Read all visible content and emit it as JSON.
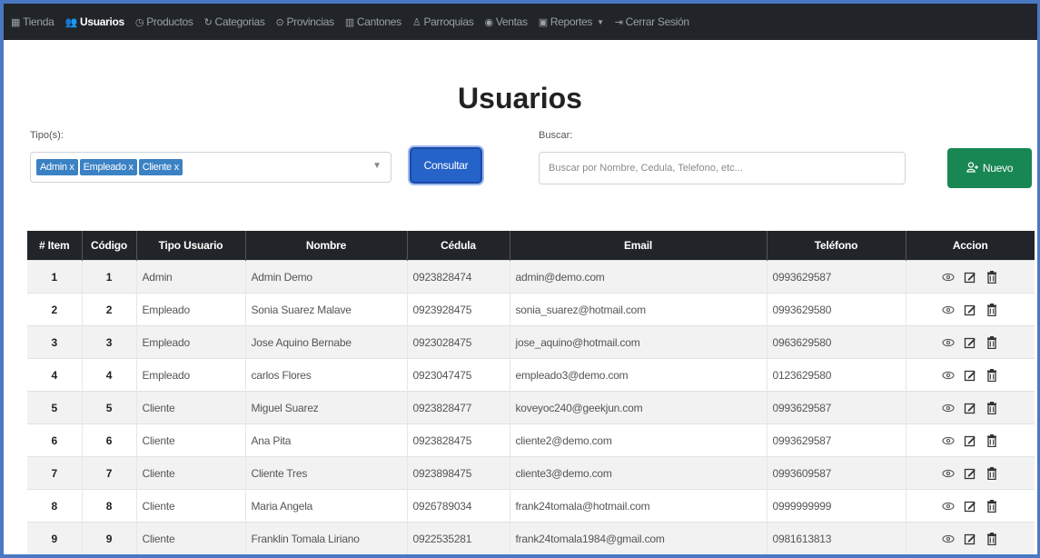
{
  "nav": {
    "items": [
      {
        "label": "Tienda",
        "icon": "store-icon",
        "glyph": "▦",
        "active": false
      },
      {
        "label": "Usuarios",
        "icon": "users-icon",
        "glyph": "👥",
        "active": true
      },
      {
        "label": "Productos",
        "icon": "clock-icon",
        "glyph": "◷",
        "active": false
      },
      {
        "label": "Categorias",
        "icon": "tag-icon",
        "glyph": "↻",
        "active": false
      },
      {
        "label": "Provincias",
        "icon": "map-pin-icon",
        "glyph": "⊙",
        "active": false
      },
      {
        "label": "Cantones",
        "icon": "columns-icon",
        "glyph": "▥",
        "active": false
      },
      {
        "label": "Parroquias",
        "icon": "person-icon",
        "glyph": "♙",
        "active": false
      },
      {
        "label": "Ventas",
        "icon": "coin-icon",
        "glyph": "◉",
        "active": false
      },
      {
        "label": "Reportes",
        "icon": "report-icon",
        "glyph": "▣",
        "active": false,
        "dropdown": true
      },
      {
        "label": "Cerrar Sesión",
        "icon": "logout-icon",
        "glyph": "⇥",
        "active": false
      }
    ]
  },
  "page": {
    "title": "Usuarios"
  },
  "filters": {
    "tipo_label": "Tipo(s):",
    "chips": [
      "Admin x",
      "Empleado x",
      "Cliente x"
    ],
    "consultar_label": "Consultar",
    "buscar_label": "Buscar:",
    "search_placeholder": "Buscar por Nombre, Cedula, Telefono, etc...",
    "search_value": "",
    "nuevo_label": "Nuevo"
  },
  "table": {
    "headers": [
      "# Item",
      "Código",
      "Tipo Usuario",
      "Nombre",
      "Cédula",
      "Email",
      "Teléfono",
      "Accion"
    ],
    "rows": [
      [
        "1",
        "1",
        "Admin",
        "Admin Demo",
        "0923828474",
        "admin@demo.com",
        "0993629587"
      ],
      [
        "2",
        "2",
        "Empleado",
        "Sonia Suarez Malave",
        "0923928475",
        "sonia_suarez@hotmail.com",
        "0993629580"
      ],
      [
        "3",
        "3",
        "Empleado",
        "Jose Aquino Bernabe",
        "0923028475",
        "jose_aquino@hotmail.com",
        "0963629580"
      ],
      [
        "4",
        "4",
        "Empleado",
        "carlos Flores",
        "0923047475",
        "empleado3@demo.com",
        "0123629580"
      ],
      [
        "5",
        "5",
        "Cliente",
        "Miguel Suarez",
        "0923828477",
        "koveyoc240@geekjun.com",
        "0993629587"
      ],
      [
        "6",
        "6",
        "Cliente",
        "Ana Pita",
        "0923828475",
        "cliente2@demo.com",
        "0993629587"
      ],
      [
        "7",
        "7",
        "Cliente",
        "Cliente Tres",
        "0923898475",
        "cliente3@demo.com",
        "0993609587"
      ],
      [
        "8",
        "8",
        "Cliente",
        "Maria Angela",
        "0926789034",
        "frank24tomala@hotmail.com",
        "0999999999"
      ],
      [
        "9",
        "9",
        "Cliente",
        "Franklin Tomala Liriano",
        "0922535281",
        "frank24tomala1984@gmail.com",
        "0981613813"
      ]
    ],
    "actions": [
      "view-icon",
      "edit-icon",
      "delete-icon"
    ]
  },
  "colors": {
    "navbar": "#212529",
    "consultar": "#2563c9",
    "nuevo": "#198754",
    "chip": "#3b82c4",
    "frame": "#4a78c2"
  }
}
